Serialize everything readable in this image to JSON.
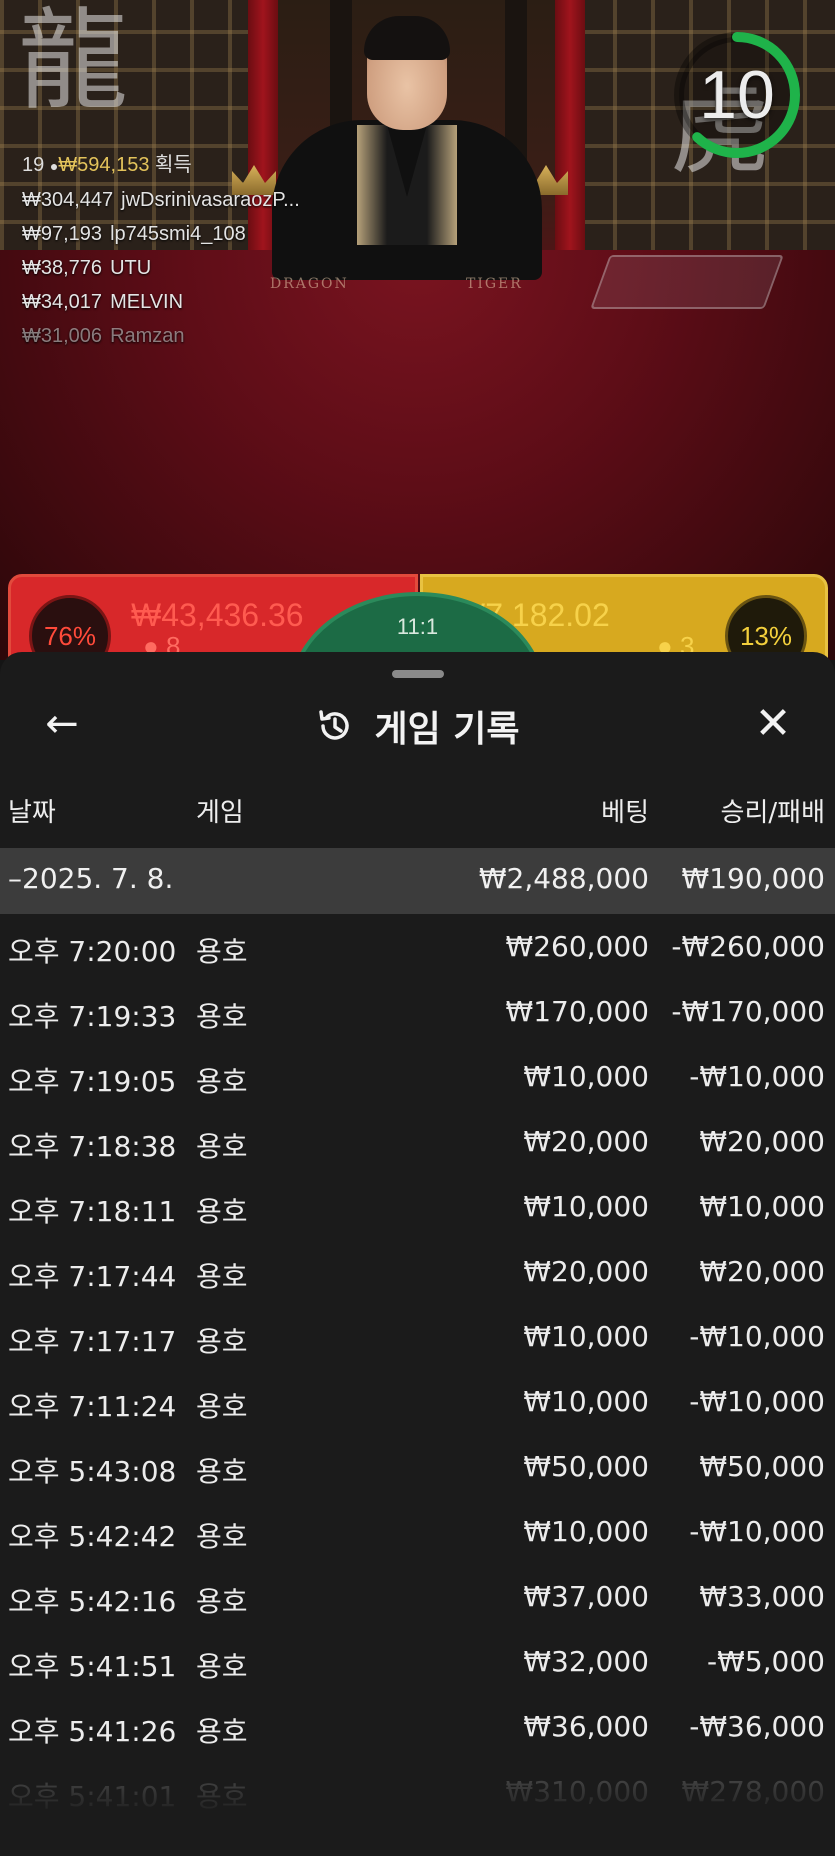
{
  "timer": {
    "value": "10",
    "progress": 0.62,
    "color": "#1fb34a"
  },
  "leaderboard": {
    "count": "19",
    "total": "₩594,153",
    "suffix": "획득",
    "rows": [
      {
        "amount": "₩304,447",
        "name": "jwDsrinivasaraozP..."
      },
      {
        "amount": "₩97,193",
        "name": "lp745smi4_108"
      },
      {
        "amount": "₩38,776",
        "name": "UTU"
      },
      {
        "amount": "₩34,017",
        "name": "MELVIN"
      },
      {
        "amount": "₩31,006",
        "name": "Ramzan"
      }
    ]
  },
  "table": {
    "dragon_label": "DRAGON",
    "tiger_label": "TIGER"
  },
  "bets": {
    "dragon": {
      "percent": "76%",
      "pool": "₩43,436.36",
      "players": "8",
      "color": "#d8282a"
    },
    "tiger": {
      "percent": "13%",
      "pool": "₩7,182.02",
      "players": "3",
      "color": "#d7a91f"
    },
    "tie": {
      "odds": "11:1",
      "color": "#1c6b45"
    }
  },
  "history": {
    "title": "게임 기록",
    "columns": {
      "date": "날짜",
      "game": "게임",
      "bet": "베팅",
      "result": "승리/패배"
    },
    "summary": {
      "date": "–2025. 7. 8.",
      "bet": "₩2,488,000",
      "result": "₩190,000"
    },
    "rows": [
      {
        "date": "오후 7:20:00",
        "game": "용호",
        "bet": "₩260,000",
        "result": "-₩260,000"
      },
      {
        "date": "오후 7:19:33",
        "game": "용호",
        "bet": "₩170,000",
        "result": "-₩170,000"
      },
      {
        "date": "오후 7:19:05",
        "game": "용호",
        "bet": "₩10,000",
        "result": "-₩10,000"
      },
      {
        "date": "오후 7:18:38",
        "game": "용호",
        "bet": "₩20,000",
        "result": "₩20,000"
      },
      {
        "date": "오후 7:18:11",
        "game": "용호",
        "bet": "₩10,000",
        "result": "₩10,000"
      },
      {
        "date": "오후 7:17:44",
        "game": "용호",
        "bet": "₩20,000",
        "result": "₩20,000"
      },
      {
        "date": "오후 7:17:17",
        "game": "용호",
        "bet": "₩10,000",
        "result": "-₩10,000"
      },
      {
        "date": "오후 7:11:24",
        "game": "용호",
        "bet": "₩10,000",
        "result": "-₩10,000"
      },
      {
        "date": "오후 5:43:08",
        "game": "용호",
        "bet": "₩50,000",
        "result": "₩50,000"
      },
      {
        "date": "오후 5:42:42",
        "game": "용호",
        "bet": "₩10,000",
        "result": "-₩10,000"
      },
      {
        "date": "오후 5:42:16",
        "game": "용호",
        "bet": "₩37,000",
        "result": "₩33,000"
      },
      {
        "date": "오후 5:41:51",
        "game": "용호",
        "bet": "₩32,000",
        "result": "-₩5,000"
      },
      {
        "date": "오후 5:41:26",
        "game": "용호",
        "bet": "₩36,000",
        "result": "-₩36,000"
      },
      {
        "date": "오후 5:41:01",
        "game": "용호",
        "bet": "₩310,000",
        "result": "₩278,000"
      }
    ]
  }
}
